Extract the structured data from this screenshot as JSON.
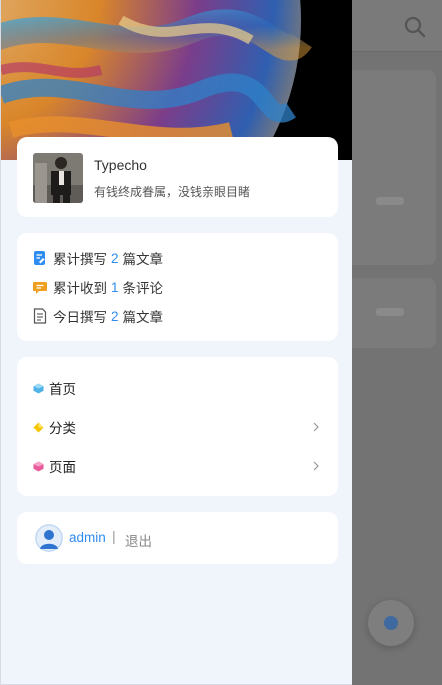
{
  "profile": {
    "site_name": "Typecho",
    "site_desc": "有钱终成眷属，没钱亲眼目睹"
  },
  "stats": [
    {
      "icon": "edit-doc-icon",
      "prefix": "累计撰写",
      "count": "2",
      "suffix": "篇文章",
      "color": "#2f8cf0"
    },
    {
      "icon": "comment-icon",
      "prefix": "累计收到",
      "count": "1",
      "suffix": "条评论",
      "color": "#f0a020"
    },
    {
      "icon": "document-icon",
      "prefix": "今日撰写",
      "count": "2",
      "suffix": "篇文章",
      "color": "#555555"
    }
  ],
  "menu": {
    "items": [
      {
        "label": "首页",
        "icon": "home-gem-icon",
        "color": "#4fb3e8",
        "has_submenu": false
      },
      {
        "label": "分类",
        "icon": "category-gem-icon",
        "color": "#f5c400",
        "has_submenu": true
      },
      {
        "label": "页面",
        "icon": "page-gem-icon",
        "color": "#e85a9a",
        "has_submenu": true
      }
    ]
  },
  "user": {
    "name": "admin",
    "separator": "|",
    "logout_label": "退出"
  },
  "colors": {
    "accent": "#2f8cf0",
    "drawer_bg": "#f0f4fb",
    "overlay": "#737373"
  }
}
